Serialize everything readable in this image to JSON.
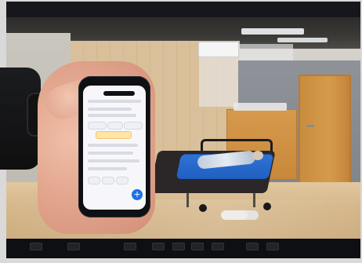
{
  "scene": {
    "monitor_top_text_left": "",
    "monitor_top_text_right": "",
    "toolbar_labels": [
      "",
      "",
      "",
      "",
      "",
      "",
      "",
      "",
      ""
    ],
    "brand": ""
  },
  "icons": {
    "fab_glyph": "+"
  }
}
